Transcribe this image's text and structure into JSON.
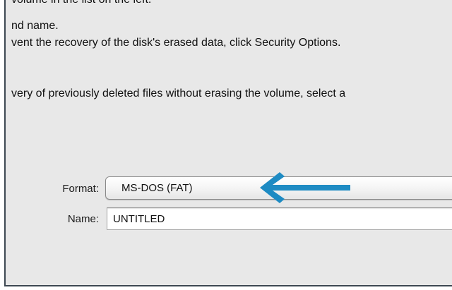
{
  "instructions": [
    "volume in the list on the left.",
    "nd name.",
    "vent the recovery of the disk's erased data, click Security Options.",
    "very of previously deleted files without erasing the volume, select a"
  ],
  "format": {
    "label": "Format:",
    "selected": "MS-DOS (FAT)"
  },
  "name": {
    "label": "Name:",
    "value": "UNTITLED"
  },
  "colors": {
    "arrow": "#1e8bc3",
    "frame_border": "#3d4852",
    "panel_background": "#e8e8e8"
  },
  "icons": {
    "annotation": "left-arrow-icon"
  }
}
